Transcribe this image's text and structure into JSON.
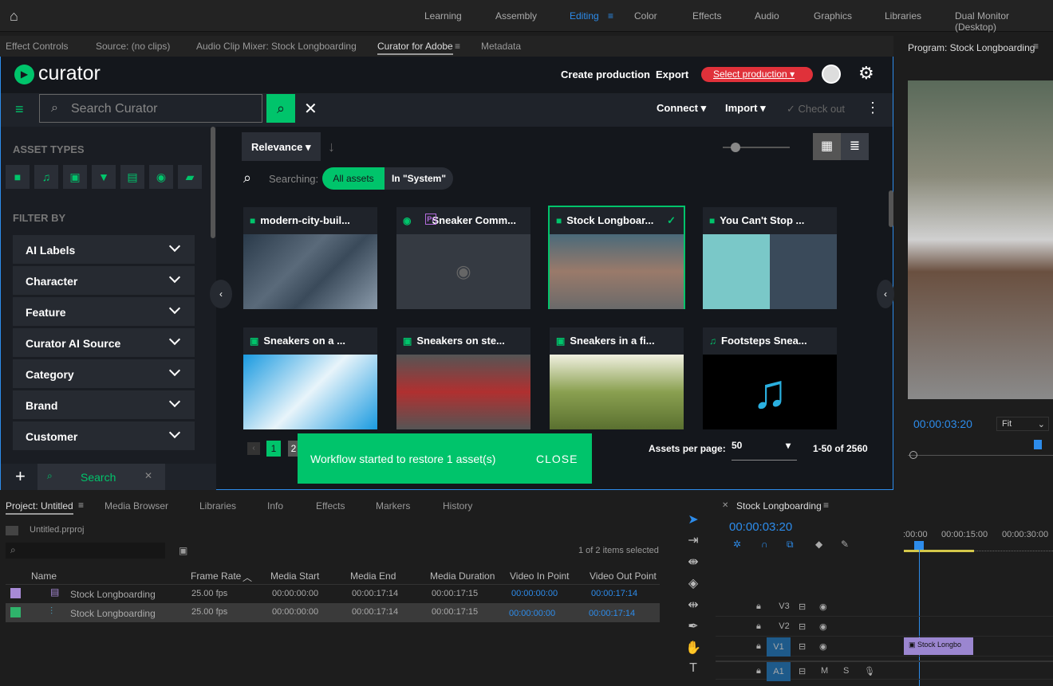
{
  "topbar": {
    "workspaces": [
      "Learning",
      "Assembly",
      "Editing",
      "Color",
      "Effects",
      "Audio",
      "Graphics",
      "Libraries",
      "Dual Monitor (Desktop)"
    ],
    "active": "Editing"
  },
  "panel_tabs": [
    "Effect Controls",
    "Source: (no clips)",
    "Audio Clip Mixer: Stock Longboarding",
    "Curator for Adobe",
    "Metadata"
  ],
  "curator": {
    "logo": "curator",
    "create": "Create production",
    "export": "Export",
    "select": "Select production",
    "search_placeholder": "Search Curator",
    "connect": "Connect",
    "import": "Import",
    "checkout": "Check out"
  },
  "sidebar": {
    "asset_types": "ASSET TYPES",
    "filter_by": "FILTER BY",
    "filters": [
      "AI Labels",
      "Character",
      "Feature",
      "Curator AI Source",
      "Category",
      "Brand",
      "Customer"
    ],
    "search_tab": "Search"
  },
  "toolbar": {
    "sort": "Relevance",
    "searching": "Searching:",
    "all_assets": "All assets",
    "in_system": "In \"System\""
  },
  "cards": [
    {
      "title": "modern-city-buil...",
      "icon": "video"
    },
    {
      "title": "Sneaker Comm...",
      "icon": "premiere"
    },
    {
      "title": "Stock Longboar...",
      "icon": "video"
    },
    {
      "title": "You Can't Stop ...",
      "icon": "video"
    },
    {
      "title": "Sneakers on a ...",
      "icon": "image"
    },
    {
      "title": "Sneakers on ste...",
      "icon": "image"
    },
    {
      "title": "Sneakers in a fi...",
      "icon": "image"
    },
    {
      "title": "Footsteps Snea...",
      "icon": "audio"
    }
  ],
  "pagination": {
    "page1": "1",
    "page2": "2",
    "per_page_label": "Assets per page:",
    "per_page": "50",
    "range": "1-50 of 2560"
  },
  "toast": {
    "message": "Workflow started to restore 1 asset(s)",
    "action": "CLOSE"
  },
  "project": {
    "tabs": [
      "Project: Untitled",
      "Media Browser",
      "Libraries",
      "Info",
      "Effects",
      "Markers",
      "History"
    ],
    "file": "Untitled.prproj",
    "selected": "1 of 2 items selected",
    "columns": [
      "Name",
      "Frame Rate",
      "Media Start",
      "Media End",
      "Media Duration",
      "Video In Point",
      "Video Out Point"
    ],
    "rows": [
      [
        "Stock Longboarding",
        "25.00 fps",
        "00:00:00:00",
        "00:00:17:14",
        "00:00:17:15",
        "00:00:00:00",
        "00:00:17:14"
      ],
      [
        "Stock Longboarding",
        "25.00 fps",
        "00:00:00:00",
        "00:00:17:14",
        "00:00:17:15",
        "00:00:00:00",
        "00:00:17:14"
      ]
    ]
  },
  "timeline": {
    "title": "Stock Longboarding",
    "timecode": "00:00:03:20",
    "ticks": [
      ":00:00",
      "00:00:15:00",
      "00:00:30:00"
    ],
    "tracks": [
      "V3",
      "V2",
      "V1",
      "A1"
    ],
    "clip": "Stock Longbo"
  },
  "program": {
    "title": "Program: Stock Longboarding",
    "timecode": "00:00:03:20",
    "fit": "Fit"
  },
  "colors": {
    "accent": "#00c46b",
    "blue": "#2d8ceb",
    "red": "#e0313a"
  }
}
